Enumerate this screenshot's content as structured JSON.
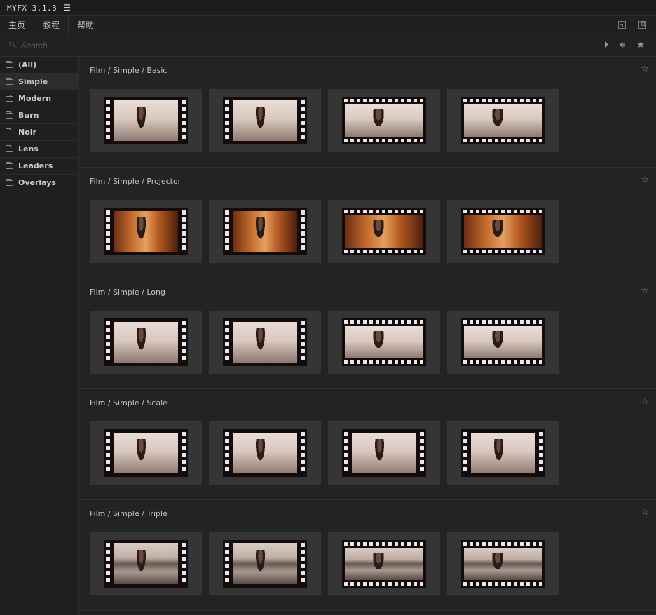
{
  "app": {
    "title": "MYFX 3.1.3"
  },
  "nav": {
    "tabs": [
      "主页",
      "教程",
      "帮助"
    ]
  },
  "search": {
    "placeholder": "Search"
  },
  "sidebar": {
    "items": [
      {
        "label": "(All)"
      },
      {
        "label": "Simple",
        "active": true
      },
      {
        "label": "Modern"
      },
      {
        "label": "Burn"
      },
      {
        "label": "Noir"
      },
      {
        "label": "Lens"
      },
      {
        "label": "Leaders"
      },
      {
        "label": "Overlays"
      }
    ]
  },
  "sections": [
    {
      "title": "Film / Simple / Basic",
      "thumbs": [
        "v",
        "v",
        "h",
        "h"
      ],
      "look": ""
    },
    {
      "title": "Film / Simple / Projector",
      "thumbs": [
        "v",
        "v",
        "h",
        "h"
      ],
      "look": "proj"
    },
    {
      "title": "Film / Simple / Long",
      "thumbs": [
        "v",
        "v",
        "h",
        "h"
      ],
      "look": ""
    },
    {
      "title": "Film / Simple / Scale",
      "thumbs": [
        "v",
        "v",
        "v",
        "v"
      ],
      "look": ""
    },
    {
      "title": "Film / Simple / Triple",
      "thumbs": [
        "v",
        "v",
        "h",
        "h"
      ],
      "look": "triple"
    }
  ]
}
